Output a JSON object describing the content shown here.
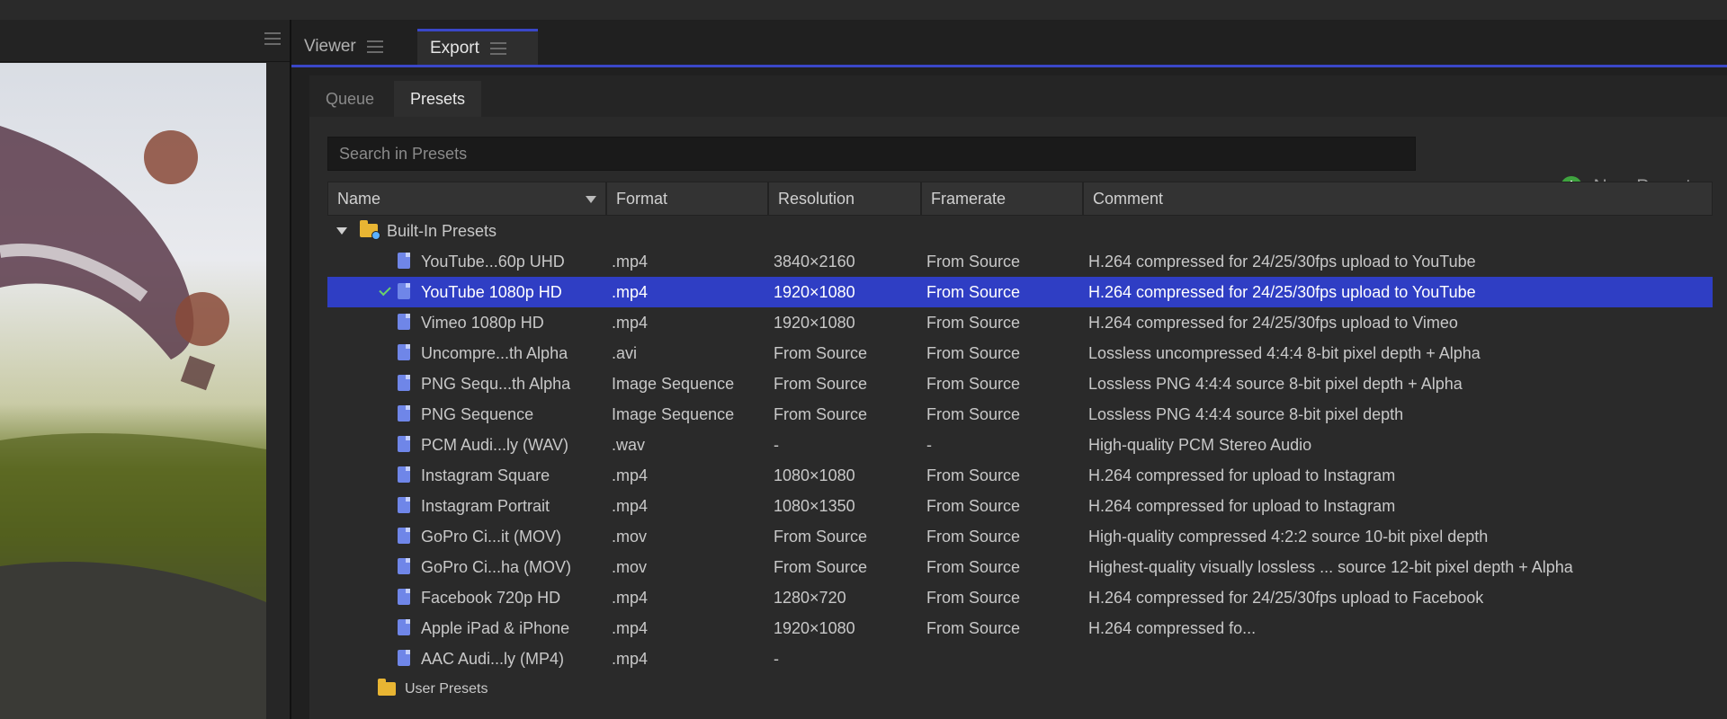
{
  "panel_tabs": [
    {
      "label": "Viewer",
      "active": false
    },
    {
      "label": "Export",
      "active": true
    }
  ],
  "sub_tabs": [
    {
      "label": "Queue",
      "active": false
    },
    {
      "label": "Presets",
      "active": true
    }
  ],
  "search": {
    "placeholder": "Search in Presets"
  },
  "new_preset_label": "New Preset",
  "columns": [
    "Name",
    "Format",
    "Resolution",
    "Framerate",
    "Comment"
  ],
  "groups": {
    "builtin": "Built-In Presets",
    "user": "User Presets"
  },
  "rows": [
    {
      "name": "YouTube...60p UHD",
      "format": ".mp4",
      "resolution": "3840×2160",
      "framerate": "From Source",
      "comment": "H.264 compressed for 24/25/30fps upload to YouTube",
      "selected": false
    },
    {
      "name": "YouTube 1080p HD",
      "format": ".mp4",
      "resolution": "1920×1080",
      "framerate": "From Source",
      "comment": "H.264 compressed for 24/25/30fps upload to YouTube",
      "selected": true
    },
    {
      "name": "Vimeo 1080p HD",
      "format": ".mp4",
      "resolution": "1920×1080",
      "framerate": "From Source",
      "comment": "H.264 compressed for 24/25/30fps upload to Vimeo",
      "selected": false
    },
    {
      "name": "Uncompre...th Alpha",
      "format": ".avi",
      "resolution": "From Source",
      "framerate": "From Source",
      "comment": "Lossless uncompressed 4:4:4 8-bit pixel depth + Alpha",
      "selected": false
    },
    {
      "name": "PNG Sequ...th Alpha",
      "format": "Image Sequence",
      "resolution": "From Source",
      "framerate": "From Source",
      "comment": "Lossless PNG 4:4:4 source 8-bit pixel depth + Alpha",
      "selected": false
    },
    {
      "name": "PNG Sequence",
      "format": "Image Sequence",
      "resolution": "From Source",
      "framerate": "From Source",
      "comment": "Lossless PNG 4:4:4 source 8-bit pixel depth",
      "selected": false
    },
    {
      "name": "PCM Audi...ly (WAV)",
      "format": ".wav",
      "resolution": "-",
      "framerate": "-",
      "comment": "High-quality PCM Stereo Audio",
      "selected": false
    },
    {
      "name": "Instagram Square",
      "format": ".mp4",
      "resolution": "1080×1080",
      "framerate": "From Source",
      "comment": "H.264 compressed for upload to Instagram",
      "selected": false
    },
    {
      "name": "Instagram Portrait",
      "format": ".mp4",
      "resolution": "1080×1350",
      "framerate": "From Source",
      "comment": "H.264 compressed for upload to Instagram",
      "selected": false
    },
    {
      "name": "GoPro Ci...it (MOV)",
      "format": ".mov",
      "resolution": "From Source",
      "framerate": "From Source",
      "comment": "High-quality compressed 4:2:2 source 10-bit pixel depth",
      "selected": false
    },
    {
      "name": "GoPro Ci...ha (MOV)",
      "format": ".mov",
      "resolution": "From Source",
      "framerate": "From Source",
      "comment": "Highest-quality visually lossless ... source 12-bit pixel depth + Alpha",
      "selected": false
    },
    {
      "name": "Facebook 720p HD",
      "format": ".mp4",
      "resolution": "1280×720",
      "framerate": "From Source",
      "comment": "H.264 compressed for 24/25/30fps upload to Facebook",
      "selected": false
    },
    {
      "name": "Apple iPad & iPhone",
      "format": ".mp4",
      "resolution": "1920×1080",
      "framerate": "From Source",
      "comment": "H.264 compressed fo...",
      "selected": false
    },
    {
      "name": "AAC Audi...ly (MP4)",
      "format": ".mp4",
      "resolution": "-",
      "framerate": "",
      "comment": "",
      "selected": false
    }
  ]
}
